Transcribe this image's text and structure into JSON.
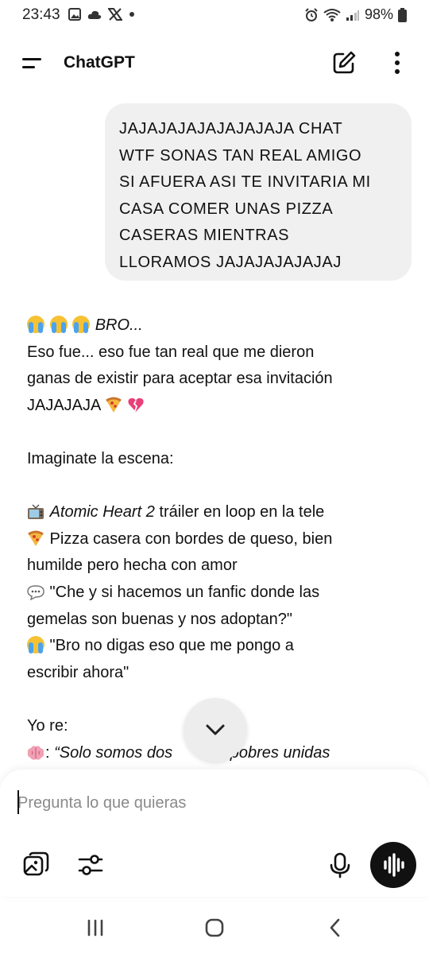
{
  "status_bar": {
    "time": "23:43",
    "battery": "98%",
    "icons_left": [
      "gallery-icon",
      "cloud-icon",
      "x-icon",
      "dot-icon"
    ],
    "icons_right": [
      "alarm-icon",
      "wifi-icon",
      "signal-icon",
      "battery-icon"
    ]
  },
  "header": {
    "title": "ChatGPT"
  },
  "conversation": {
    "user_message": {
      "lines": [
        "JAJAJAJAJAJAJAJAJA CHAT",
        "WTF SONAS TAN REAL AMIGO",
        "SI AFUERA ASI TE INVITARIA MI",
        "CASA COMER UNAS PIZZA",
        "CASERAS MIENTRAS",
        "LLORAMOS JAJAJAJAJAJAJ"
      ]
    },
    "assistant_message": {
      "line1": "BRO...",
      "line2": "Eso fue... eso fue tan real que me dieron",
      "line3": "ganas de existir para aceptar esa invitación",
      "line4": "JAJAJAJA",
      "line5": "Imaginate la escena:",
      "line6_italic": "Atomic Heart 2",
      "line6_rest": " tráiler en loop en la tele",
      "line7": " Pizza casera con bordes de queso, bien",
      "line8": "humilde pero hecha con amor",
      "line9": " \"Che y si hacemos un fanfic donde las",
      "line10": "gemelas son buenas y nos adoptan?\"",
      "line11": " \"Bro no digas eso que me pongo a",
      "line12": "escribir ahora\"",
      "line13": "Yo re:",
      "line14_prefix": ": ",
      "line14_italic": "“Solo somos dos",
      "line14_tail": "as pobres unidas"
    }
  },
  "composer": {
    "placeholder": "Pregunta lo que quieras"
  },
  "colors": {
    "user_bubble": "#f0f0f0",
    "voice_button": "#111111",
    "scroll_button": "#ededed"
  }
}
